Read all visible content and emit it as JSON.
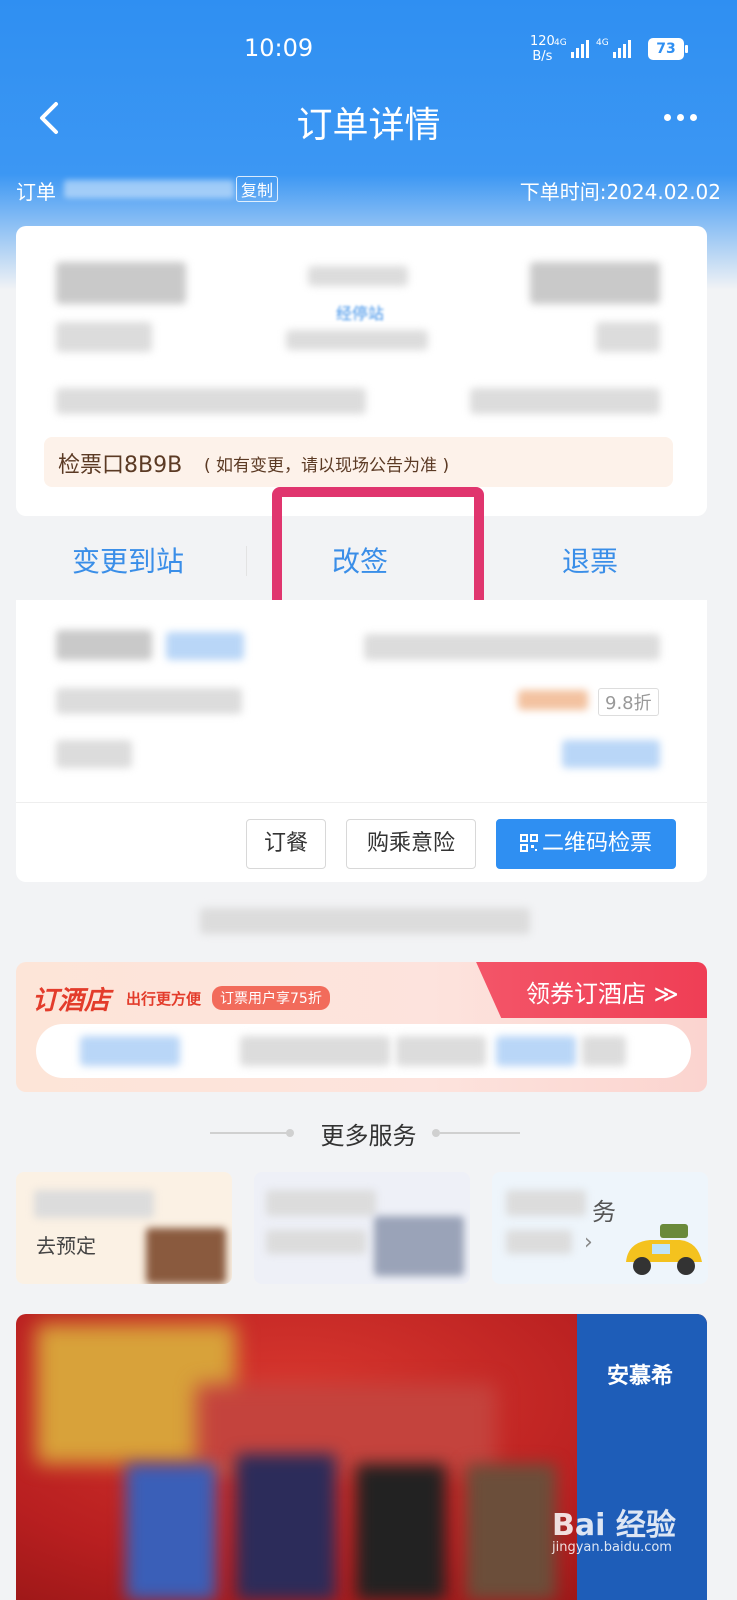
{
  "status": {
    "time": "10:09",
    "net_speed_value": "120",
    "net_speed_unit": "B/s",
    "battery": "73",
    "signal_tags": [
      "4G",
      "4G"
    ]
  },
  "nav": {
    "title": "订单详情",
    "back_icon": "back-chevron-icon",
    "more_icon": "more-dots-icon"
  },
  "order": {
    "number_label": "订单",
    "copy_label": "复制",
    "time_text": "下单时间:2024.02.02"
  },
  "trip": {
    "via_label": "经停站",
    "gate_text": "检票口8B9B",
    "gate_note": "( 如有变更，请以现场公告为准 )"
  },
  "actions": {
    "change_station": "变更到站",
    "reschedule": "改签",
    "refund": "退票"
  },
  "passenger": {
    "discount": "9.8折"
  },
  "buttons": {
    "meal": "订餐",
    "insurance": "购乘意险",
    "qr_ticket": "二维码检票"
  },
  "hotel": {
    "title": "订酒店",
    "subtitle": "出行更方便",
    "badge": "订票用户享75折",
    "cta": "领券订酒店 ≫"
  },
  "more_services": {
    "title": "更多服务",
    "partial_text": "务",
    "left_partial": "去预定"
  },
  "promo": {
    "brand": "安慕希"
  },
  "watermark": {
    "main": "Bai 经验",
    "sub": "jingyan.baidu.com"
  },
  "colors": {
    "header_blue": "#2f8ff2",
    "action_blue": "#3a8ee8",
    "highlight": "#e0356e",
    "hotel_red": "#e33c2b"
  }
}
